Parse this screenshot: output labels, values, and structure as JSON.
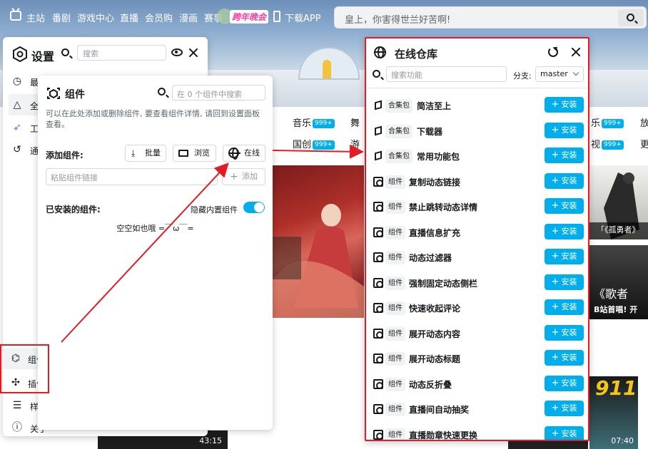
{
  "topnav": {
    "items": [
      "主站",
      "番剧",
      "游戏中心",
      "直播",
      "会员购",
      "漫画",
      "赛事"
    ],
    "badge": "跨年晚会",
    "download": "下载APP",
    "search_placeholder": "皇上，你害得世兰好苦啊!"
  },
  "categories": {
    "row1": [
      {
        "label": "音乐",
        "count": "999+"
      },
      {
        "label": "舞"
      },
      {
        "label": "乐",
        "count": "999+"
      },
      {
        "label": "放"
      }
    ],
    "row2": [
      {
        "label": "国创",
        "count": "999+"
      },
      {
        "label": "游"
      },
      {
        "label": "视",
        "count": "999+"
      },
      {
        "label": "更"
      }
    ]
  },
  "cards": {
    "right_top_caption": "「《孤勇者》",
    "right_mid_caption": "B站首唱! 开",
    "right_mid_calligraphy": "《歌者",
    "duration_left": "43:15",
    "duration_right": "07:40",
    "poster_text": "911"
  },
  "settings": {
    "title": "设置",
    "search_placeholder": "搜索",
    "items": [
      {
        "label": "最近",
        "icon": "clock-icon"
      },
      {
        "label": "全部",
        "icon": "shapes-icon"
      },
      {
        "label": "工具",
        "icon": "rocket-icon"
      },
      {
        "label": "通用",
        "icon": "history-icon"
      },
      {
        "label": "组件",
        "icon": "widget-icon"
      },
      {
        "label": "插件",
        "icon": "puzzle-icon"
      },
      {
        "label": "样式",
        "icon": "sliders-icon"
      },
      {
        "label": "关于",
        "icon": "info-icon"
      }
    ]
  },
  "components": {
    "title": "组件",
    "search_placeholder": "在 0 个组件中搜索",
    "description": "可以在此处添加或删除组件, 要查看组件详情, 请回到设置面板查看。",
    "add_label": "添加组件:",
    "batch_label": "批量",
    "browse_label": "浏览",
    "online_label": "在线",
    "link_placeholder": "粘贴组件链接",
    "add_button": "添加",
    "installed_label": "已安装的组件:",
    "hide_builtin_label": "隐藏内置组件",
    "hide_builtin_on": true,
    "empty_text": "空空如也哦 =￣ω￣="
  },
  "online": {
    "title": "在线仓库",
    "search_placeholder": "搜索功能",
    "branch_label": "分支:",
    "branch_value": "master",
    "install_label": "安装",
    "items": [
      {
        "tag": "合集包",
        "name": "简洁至上",
        "type": "package"
      },
      {
        "tag": "合集包",
        "name": "下载器",
        "type": "package"
      },
      {
        "tag": "合集包",
        "name": "常用功能包",
        "type": "package"
      },
      {
        "tag": "组件",
        "name": "复制动态链接",
        "type": "component"
      },
      {
        "tag": "组件",
        "name": "禁止跳转动态详情",
        "type": "component"
      },
      {
        "tag": "组件",
        "name": "直播信息扩充",
        "type": "component"
      },
      {
        "tag": "组件",
        "name": "动态过滤器",
        "type": "component"
      },
      {
        "tag": "组件",
        "name": "强制固定动态侧栏",
        "type": "component"
      },
      {
        "tag": "组件",
        "name": "快速收起评论",
        "type": "component"
      },
      {
        "tag": "组件",
        "name": "展开动态内容",
        "type": "component"
      },
      {
        "tag": "组件",
        "name": "展开动态标题",
        "type": "component"
      },
      {
        "tag": "组件",
        "name": "动态反折叠",
        "type": "component"
      },
      {
        "tag": "组件",
        "name": "直播间自动抽奖",
        "type": "component"
      },
      {
        "tag": "组件",
        "name": "直播勋章快速更换",
        "type": "component"
      }
    ]
  },
  "colors": {
    "accent": "#00aeec",
    "highlight": "#e31b23"
  }
}
